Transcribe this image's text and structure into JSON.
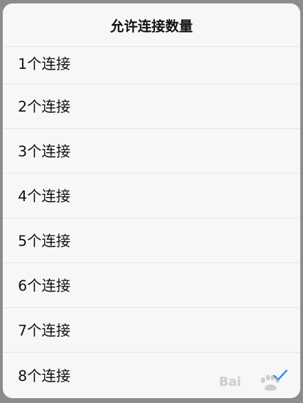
{
  "dialog": {
    "title": "允许连接数量",
    "options": [
      {
        "label": "1个连接",
        "selected": false
      },
      {
        "label": "2个连接",
        "selected": false
      },
      {
        "label": "3个连接",
        "selected": false
      },
      {
        "label": "4个连接",
        "selected": false
      },
      {
        "label": "5个连接",
        "selected": false
      },
      {
        "label": "6个连接",
        "selected": false
      },
      {
        "label": "7个连接",
        "selected": false
      },
      {
        "label": "8个连接",
        "selected": true
      }
    ],
    "check_icon": "checkmark-icon",
    "accent_color": "#2d8ff0"
  },
  "watermark": {
    "text": "Bai度"
  }
}
